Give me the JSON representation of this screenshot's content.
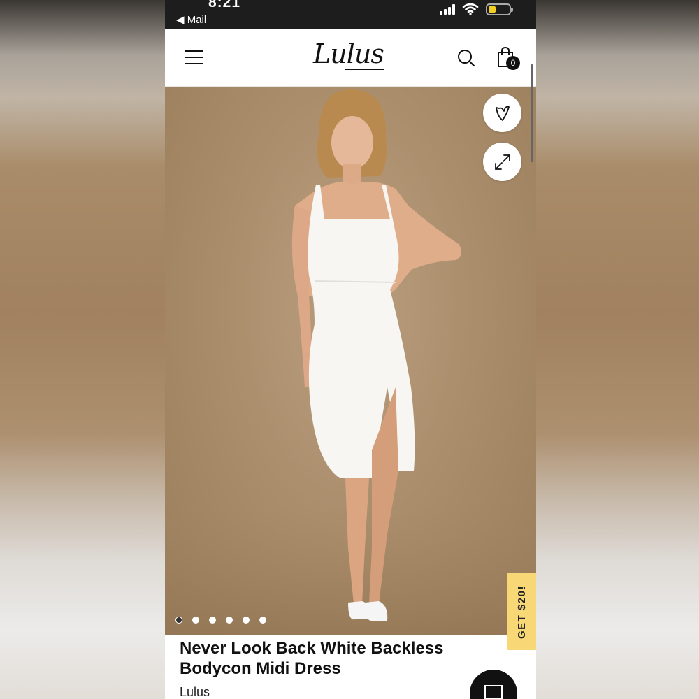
{
  "status_bar": {
    "time": "8:21",
    "back_label": "◀ Mail"
  },
  "header": {
    "logo": "Lulus",
    "cart_count": "0"
  },
  "product": {
    "title": "Never Look Back White Backless Bodycon Midi Dress",
    "brand": "Lulus",
    "image_count": 6,
    "active_image_index": 0
  },
  "promo": {
    "label": "GET $20!"
  },
  "icons": {
    "menu": "hamburger-menu-icon",
    "search": "search-icon",
    "cart": "shopping-bag-icon",
    "wishlist": "heart-icon",
    "expand": "expand-icon",
    "chat": "chat-icon"
  },
  "colors": {
    "hero_background": "#a88b69",
    "promo_background": "#f8d777",
    "text": "#111111"
  }
}
